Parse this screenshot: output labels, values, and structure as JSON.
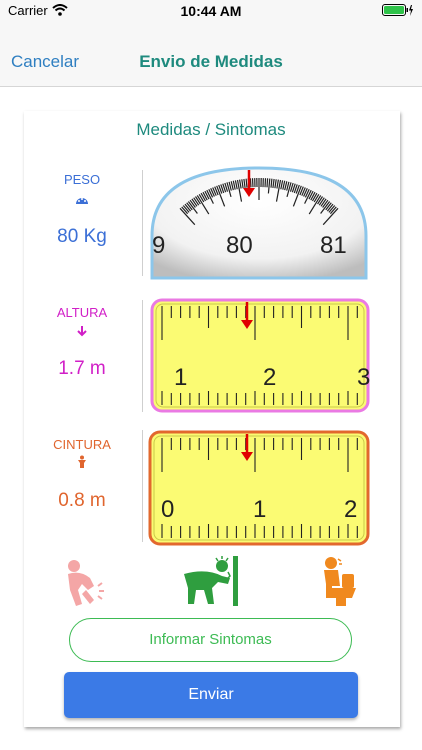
{
  "status_bar": {
    "carrier": "Carrier",
    "time": "10:44 AM"
  },
  "nav": {
    "cancel_label": "Cancelar",
    "title": "Envio de Medidas"
  },
  "section_title": "Medidas / Sintomas",
  "measures": {
    "peso": {
      "label": "PESO",
      "value": "80 Kg",
      "icon": "speedometer-icon",
      "color": "#3b6fd6",
      "scale_numbers": [
        "9",
        "80",
        "81"
      ]
    },
    "altura": {
      "label": "ALTURA",
      "value": "1.7 m",
      "icon": "arrow-down-icon",
      "color": "#d11fc7",
      "scale_numbers": [
        "1",
        "2",
        "3"
      ]
    },
    "cintura": {
      "label": "CINTURA",
      "value": "0.8 m",
      "icon": "person-icon",
      "color": "#e0652e",
      "scale_numbers": [
        "0",
        "1",
        "2"
      ]
    }
  },
  "symptoms": [
    {
      "name": "stomach-pain-icon",
      "color": "#f4a6a6"
    },
    {
      "name": "vomiting-icon",
      "color": "#2f9e3f"
    },
    {
      "name": "toilet-icon",
      "color": "#f0891e"
    }
  ],
  "buttons": {
    "report_symptoms": "Informar Sintomas",
    "send": "Enviar"
  }
}
